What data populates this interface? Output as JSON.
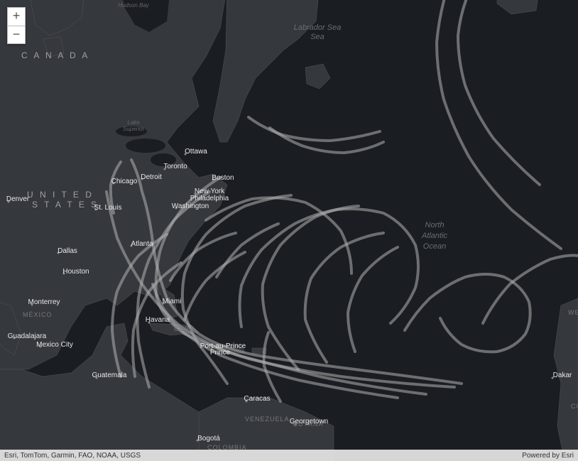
{
  "zoom": {
    "in_label": "+",
    "out_label": "−"
  },
  "attribution": {
    "left": "Esri, TomTom, Garmin, FAO, NOAA, USGS",
    "right": "Powered by Esri"
  },
  "water_labels": {
    "labrador": "Labrador Sea",
    "north_atlantic_1": "North",
    "north_atlantic_2": "Atlantic",
    "north_atlantic_3": "Ocean",
    "hudson": "Hudson Bay",
    "superior": "Lake Superior"
  },
  "countries": {
    "canada": "C A N A D A",
    "usa": "U N I T E D   S T A T E S",
    "mexico": "MÉXICO",
    "cuba": "CUBA",
    "venezuela": "VENEZUELA",
    "colombia": "COLOMBIA",
    "guyana": "GUYANA",
    "wes": "WES",
    "co": "CO"
  },
  "cities": {
    "ottawa": "Ottawa",
    "toronto": "Toronto",
    "detroit": "Detroit",
    "chicago": "Chicago",
    "boston": "Boston",
    "newyork": "New York",
    "philadelphia": "Philadelphia",
    "washington": "Washington",
    "stlouis": "St. Louis",
    "atlanta": "Atlanta",
    "miami": "Miami",
    "dallas": "Dallas",
    "houston": "Houston",
    "denver": "Denver",
    "monterrey": "Monterrey",
    "guadalajara": "Guadalajara",
    "mexicocity": "Mexico City",
    "guatemala": "Guatemala",
    "havana": "Havana",
    "portauprince": "Port-au-Prince",
    "caracas": "Caracas",
    "bogota": "Bogotá",
    "georgetown": "Georgetown",
    "dakar": "Dakar"
  }
}
